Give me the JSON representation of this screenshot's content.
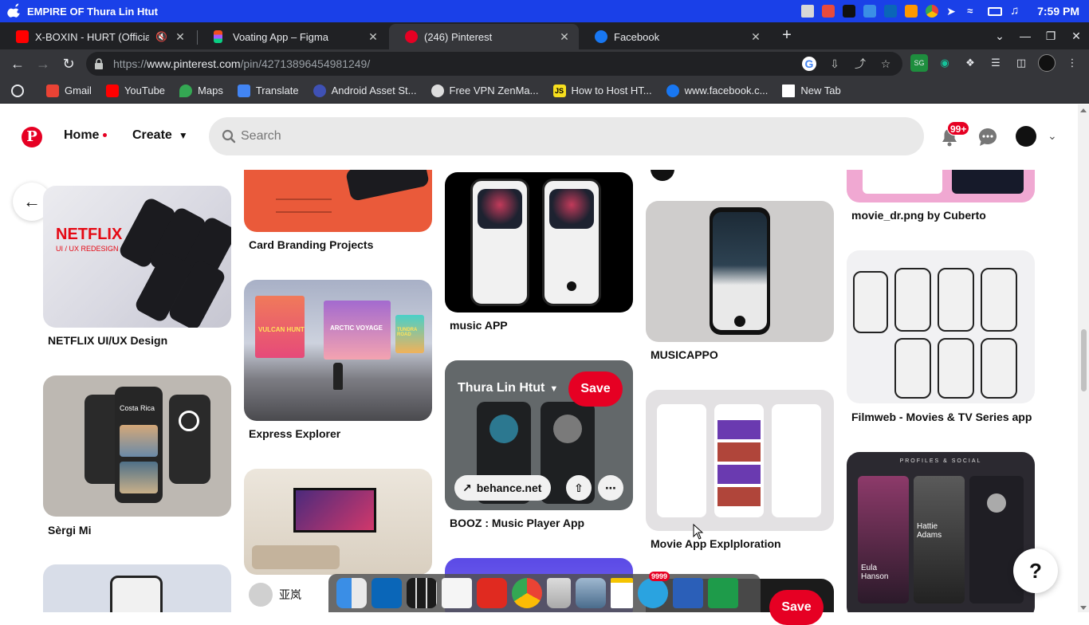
{
  "os": {
    "title": "EMPIRE OF Thura Lin Htut",
    "time": "7:59 PM",
    "tray_icons": [
      "printer-icon",
      "app-icon-red",
      "terminal-icon",
      "finder-icon",
      "vscode-icon",
      "sublime-icon",
      "chrome-icon",
      "telegram-icon",
      "wifi-icon",
      "battery-icon",
      "music-icon"
    ]
  },
  "tabs": [
    {
      "title": "X-BOXIN - HURT (Official M",
      "icon": "youtube-icon",
      "color": "#ff0000"
    },
    {
      "title": "Voating App – Figma",
      "icon": "figma-icon",
      "color": "#f24e1e"
    },
    {
      "title": "(246) Pinterest",
      "icon": "pinterest-icon",
      "color": "#e60023"
    },
    {
      "title": "Facebook",
      "icon": "facebook-icon",
      "color": "#1877f2"
    }
  ],
  "address": {
    "url_prefix": "https://",
    "url_domain": "www.pinterest.com",
    "url_path": "/pin/42713896454981249/"
  },
  "bookmarks": [
    {
      "label": "Gmail",
      "icon": "gmail-icon",
      "color": "#ea4335"
    },
    {
      "label": "YouTube",
      "icon": "youtube-icon",
      "color": "#ff0000"
    },
    {
      "label": "Maps",
      "icon": "maps-icon",
      "color": "#34a853"
    },
    {
      "label": "Translate",
      "icon": "translate-icon",
      "color": "#4285f4"
    },
    {
      "label": "Android Asset St...",
      "icon": "android-asset-icon",
      "color": "#3f51b5"
    },
    {
      "label": "Free VPN ZenMa...",
      "icon": "zenmate-icon",
      "color": "#dddddd"
    },
    {
      "label": "How to Host HT...",
      "icon": "js-icon",
      "color": "#f7df1e"
    },
    {
      "label": "www.facebook.c...",
      "icon": "facebook-icon",
      "color": "#1877f2"
    },
    {
      "label": "New Tab",
      "icon": "page-icon",
      "color": "#ffffff"
    }
  ],
  "pinterest": {
    "home_label": "Home",
    "create_label": "Create",
    "search_placeholder": "Search",
    "notification_count": "99+",
    "brand_color": "#e60023"
  },
  "pins": {
    "col1": [
      {
        "title": "NETFLIX UI/UX Design"
      },
      {
        "title": "Sèrgi Mi"
      }
    ],
    "col2": [
      {
        "title": "Card Branding Projects"
      },
      {
        "title": "Express Explorer"
      },
      {
        "author": "亚岚"
      }
    ],
    "col3": [
      {
        "title": "music APP"
      },
      {
        "title": "BOOZ : Music Player App"
      }
    ],
    "col4": [
      {
        "title": "MUSICAPPO"
      },
      {
        "title": "Movie App Explploration"
      }
    ],
    "col5": [
      {
        "title": "movie_dr.png by Cuberto"
      },
      {
        "title": "Filmweb - Movies & TV Series app"
      },
      {
        "header": "PROFILES & SOCIAL"
      }
    ]
  },
  "pin_images": {
    "netflix_brand": "NETFLIX",
    "netflix_sub": "UI / UX REDESIGN",
    "sergi_city": "Costa Rica",
    "express_cards": [
      "VULCAN HUNT",
      "ARCTIC VOYAGE",
      "TUNDRA ROAD"
    ],
    "profile_name": "Eula Hanson",
    "profile_name2": "Hattie Adams"
  },
  "overlay": {
    "board_name": "Thura Lin Htut",
    "save_label": "Save",
    "link_label": "behance.net"
  },
  "floating": {
    "save_label": "Save",
    "help_label": "?"
  },
  "dock": {
    "telegram_badge": "9999",
    "apps": [
      "finder-icon",
      "vscode-icon",
      "mission-control-icon",
      "textedit-icon",
      "pdf-reader-icon",
      "chrome-icon",
      "trash-icon",
      "preview-icon",
      "notes-icon",
      "telegram-icon",
      "word-icon",
      "spreadsheet-icon"
    ]
  }
}
